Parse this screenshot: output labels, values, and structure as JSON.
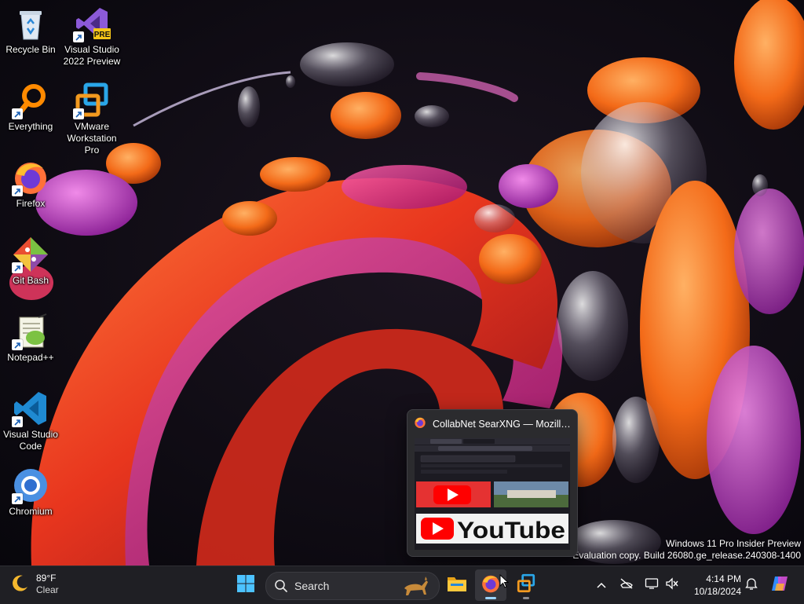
{
  "desktop": {
    "icons": [
      {
        "label": "Recycle Bin",
        "icon": "recycle-bin-icon"
      },
      {
        "label": "Visual Studio 2022 Preview",
        "icon": "visual-studio-preview-icon",
        "badge": "PRE"
      },
      {
        "label": "Everything",
        "icon": "everything-search-icon"
      },
      {
        "label": "VMware Workstation Pro",
        "icon": "vmware-icon"
      },
      {
        "label": "Firefox",
        "icon": "firefox-icon"
      },
      {
        "label": "Git Bash",
        "icon": "git-bash-icon"
      },
      {
        "label": "Notepad++",
        "icon": "notepad-plus-plus-icon"
      },
      {
        "label": "Visual Studio Code",
        "icon": "vscode-icon"
      },
      {
        "label": "Chromium",
        "icon": "chromium-icon"
      }
    ]
  },
  "watermark": {
    "line1": "Windows 11 Pro Insider Preview",
    "line2": "Evaluation copy. Build 26080.ge_release.240308-1400"
  },
  "preview": {
    "title": "CollabNet SearXNG — Mozilla F...",
    "thumbnail_text": {
      "youtube_word": "YouTube"
    }
  },
  "taskbar": {
    "weather": {
      "temperature": "89°F",
      "condition": "Clear",
      "icon": "moon-icon"
    },
    "start": {
      "icon": "windows-start-icon"
    },
    "search": {
      "placeholder": "Search"
    },
    "apps": [
      {
        "name": "File Explorer",
        "icon": "file-explorer-icon",
        "running": false
      },
      {
        "name": "Firefox",
        "icon": "firefox-icon",
        "running": true,
        "active": true
      },
      {
        "name": "VMware Workstation",
        "icon": "vmware-icon",
        "running": true
      }
    ],
    "tray": {
      "chevron": "chevron-up-icon",
      "icons": [
        "network-off-icon",
        "display-icon",
        "volume-muted-icon"
      ]
    },
    "clock": {
      "time": "4:14 PM",
      "date": "10/18/2024"
    },
    "notifications": {
      "icon": "bell-icon"
    },
    "copilot": {
      "icon": "copilot-icon"
    }
  },
  "colors": {
    "taskbar_bg": "#1f1f24",
    "accent": "#0078d4",
    "firefox_orange": "#ff7139",
    "youtube_red": "#ff0000"
  }
}
